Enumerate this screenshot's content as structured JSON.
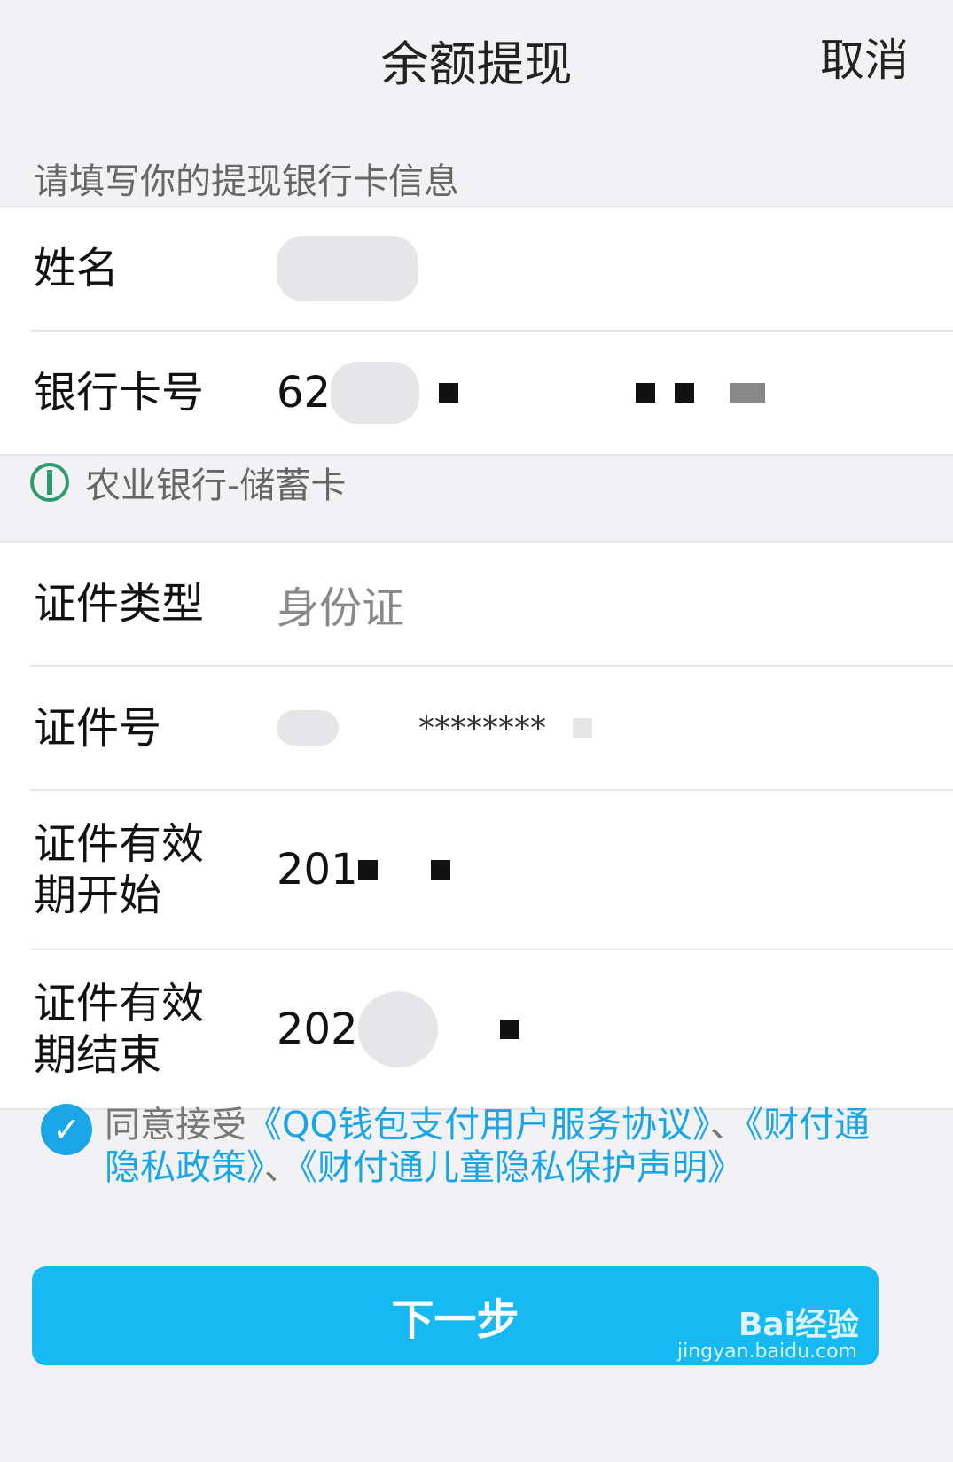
{
  "header": {
    "title": "余额提现",
    "cancel": "取消"
  },
  "hint": "请填写你的提现银行卡信息",
  "form1": {
    "name_label": "姓名",
    "card_label": "银行卡号",
    "card_prefix": "62"
  },
  "bank_info": {
    "text": "农业银行-储蓄卡",
    "icon": "abc-bank-icon"
  },
  "form2": {
    "id_type_label": "证件类型",
    "id_type_value": "身份证",
    "id_no_label": "证件号",
    "id_no_mask": "********",
    "valid_start_label_1": "证件有效",
    "valid_start_label_2": "期开始",
    "valid_start_prefix": "201",
    "valid_end_label_1": "证件有效",
    "valid_end_label_2": "期结束",
    "valid_end_prefix": "202"
  },
  "agreement": {
    "prefix": "同意接受",
    "link1": "《QQ钱包支付用户服务协议》",
    "sep1": "、",
    "link2": "《财付通隐私政策》",
    "sep2": "、",
    "link3": "《财付通儿童隐私保护声明》"
  },
  "next_button": "下一步",
  "watermark": {
    "brand": "Bai经验",
    "url": "jingyan.baidu.com"
  },
  "colors": {
    "accent": "#16b9f2",
    "link": "#1aa5e6",
    "bank_green": "#2a9d6c"
  }
}
